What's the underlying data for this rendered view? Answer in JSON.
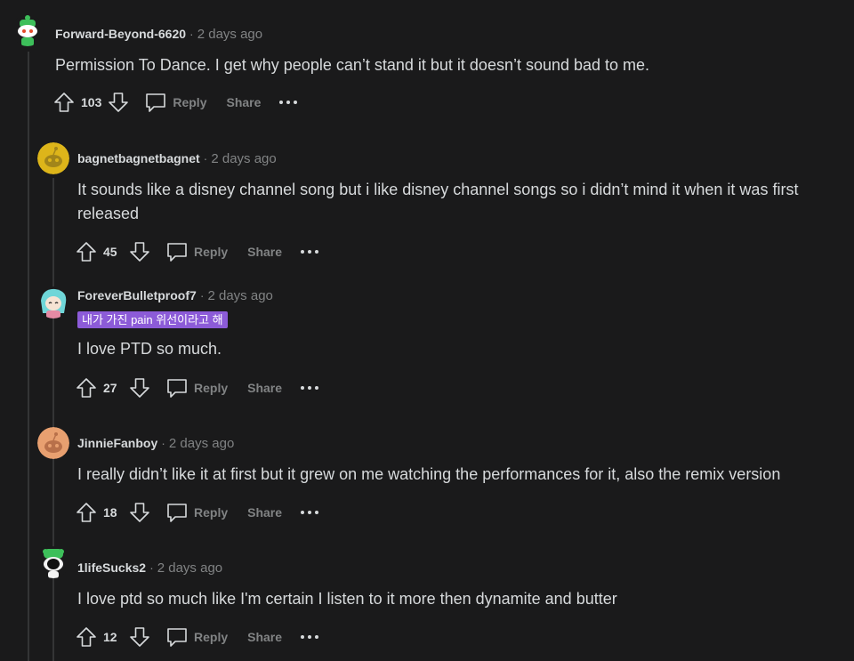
{
  "actions": {
    "reply": "Reply",
    "share": "Share"
  },
  "comments": [
    {
      "author": "Forward-Beyond-6620",
      "time": "2 days ago",
      "body": [
        "Permission To Dance. I get why people can’t stand it but it doesn’t sound bad to me."
      ],
      "score": "103",
      "flair": ""
    },
    {
      "author": "bagnetbagnetbagnet",
      "time": "2 days ago",
      "body": [
        "It sounds like a disney channel song but i like disney channel songs so i didn’t mind it when it was first",
        "released"
      ],
      "score": "45",
      "flair": ""
    },
    {
      "author": "ForeverBulletproof7",
      "time": "2 days ago",
      "body": [
        "I love PTD so much."
      ],
      "score": "27",
      "flair": "내가 가진 pain 위선이라고 해"
    },
    {
      "author": "JinnieFanboy",
      "time": "2 days ago",
      "body": [
        "I really didn’t like it at first but it grew on me watching the performances for it, also the remix version"
      ],
      "score": "18",
      "flair": ""
    },
    {
      "author": "1lifeSucks2",
      "time": "2 days ago",
      "body": [
        "I love ptd so much like I'm certain I listen to it more then dynamite and butter"
      ],
      "score": "12",
      "flair": ""
    }
  ],
  "colors": {
    "background": "#1a1a1b",
    "flair_bg": "#8c5bd8",
    "muted": "#818384",
    "text": "#d7dadc"
  }
}
